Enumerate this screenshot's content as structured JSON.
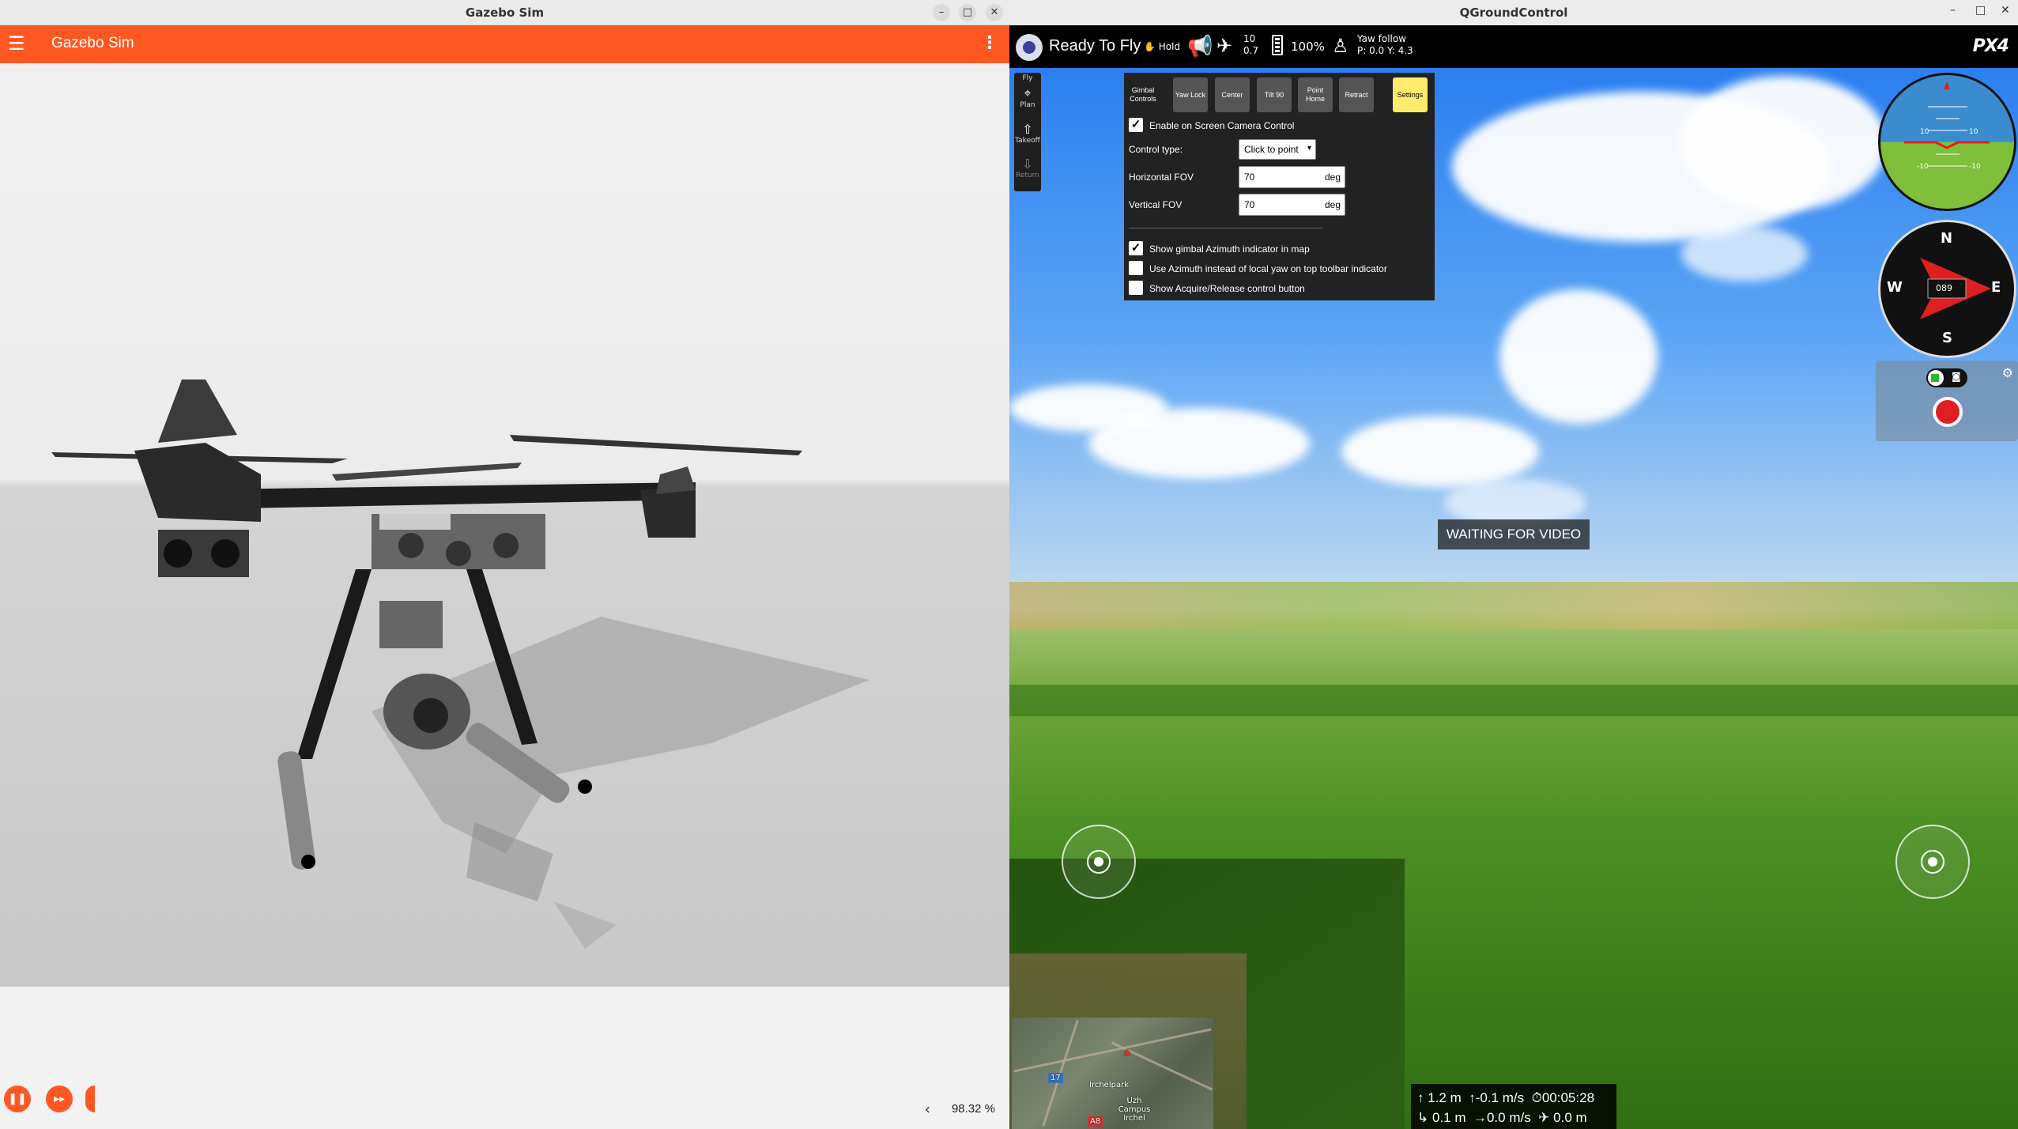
{
  "gazebo": {
    "window_title": "Gazebo Sim",
    "app_title": "Gazebo Sim",
    "rtf": "98.32 %",
    "rtf_chevron": "‹"
  },
  "qgc": {
    "window_title": "QGroundControl",
    "toolbar": {
      "status": "Ready To Fly",
      "mode": "Hold",
      "satellites": "10",
      "hdop": "0.7",
      "battery": "100%",
      "gimbal_mode": "Yaw follow",
      "gimbal_angles": "P: 0.0  Y: 4.3",
      "brand": "PX4"
    },
    "leftbar": [
      {
        "label": "Fly",
        "icon": "fly-icon"
      },
      {
        "label": "Plan",
        "icon": "plan-icon"
      },
      {
        "label": "Takeoff",
        "icon": "takeoff-icon"
      },
      {
        "label": "Return",
        "icon": "return-icon"
      }
    ],
    "gimbal_panel": {
      "tabs": [
        {
          "label": "Gimbal Controls"
        },
        {
          "label": "Yaw Lock"
        },
        {
          "label": "Center"
        },
        {
          "label": "Tilt 90"
        },
        {
          "label": "Point Home"
        },
        {
          "label": "Retract"
        },
        {
          "label": "Settings"
        }
      ],
      "enable_on_screen": "Enable on Screen Camera Control",
      "control_type_label": "Control type:",
      "control_type_value": "Click to point",
      "hfov_label": "Horizontal FOV",
      "hfov_value": "70",
      "vfov_label": "Vertical FOV",
      "vfov_value": "70",
      "unit": "deg",
      "show_azimuth": "Show gimbal Azimuth indicator in map",
      "use_azimuth": "Use Azimuth instead of local yaw on top toolbar indicator",
      "show_acquire": "Show Acquire/Release control button"
    },
    "video_status": "WAITING FOR VIDEO",
    "attitude": {
      "tick_labels": [
        "10",
        "10",
        "-10",
        "-10"
      ]
    },
    "compass": {
      "n": "N",
      "e": "E",
      "s": "S",
      "w": "W",
      "heading": "089"
    },
    "map": {
      "place1": "Irchelpark",
      "place2": "Uzh Campus Irchel",
      "shield1": "17",
      "shield2": "A8"
    },
    "telemetry": {
      "alt": "1.2 m",
      "vspeed": "-0.1 m/s",
      "time": "00:05:28",
      "dist": "0.1 m",
      "hspeed": "0.0 m/s",
      "dist_home": "0.0 m"
    }
  }
}
